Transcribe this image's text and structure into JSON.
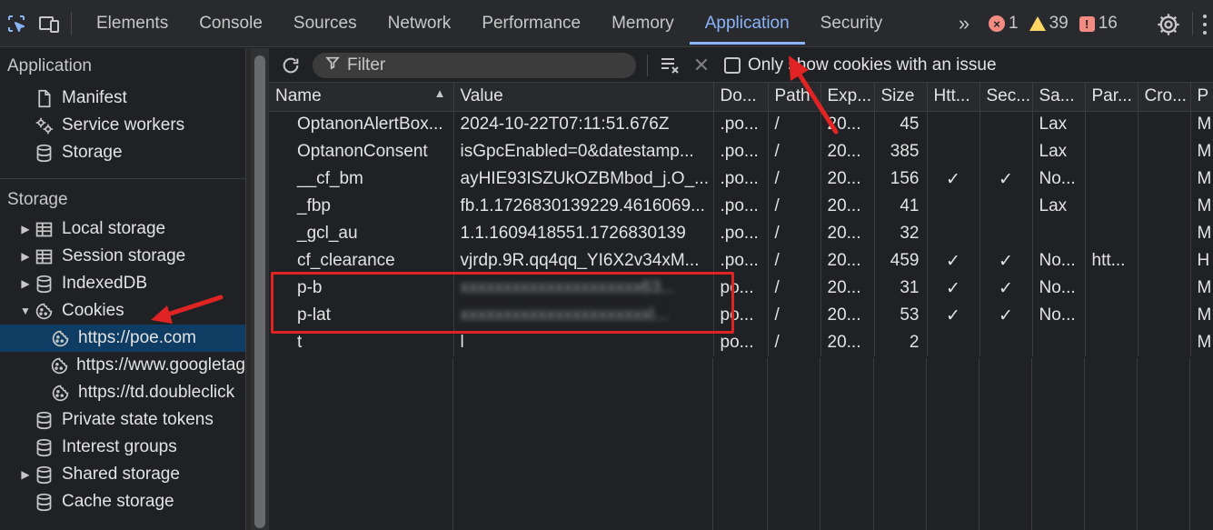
{
  "topbar": {
    "tabs": [
      "Elements",
      "Console",
      "Sources",
      "Network",
      "Performance",
      "Memory",
      "Application",
      "Security"
    ],
    "active_tab": "Application",
    "errors": "1",
    "warnings": "39",
    "issues": "16"
  },
  "sidebar": {
    "application_header": "Application",
    "application_items": [
      {
        "label": "Manifest",
        "icon": "file-icon"
      },
      {
        "label": "Service workers",
        "icon": "gears-icon"
      },
      {
        "label": "Storage",
        "icon": "database-icon"
      }
    ],
    "storage_header": "Storage",
    "storage_items": [
      {
        "label": "Local storage",
        "icon": "grid-icon"
      },
      {
        "label": "Session storage",
        "icon": "grid-icon"
      },
      {
        "label": "IndexedDB",
        "icon": "database-icon"
      },
      {
        "label": "Cookies",
        "icon": "cookie-icon"
      }
    ],
    "cookie_origins": [
      "https://poe.com",
      "https://www.googletag",
      "https://td.doubleclick"
    ],
    "selected_origin": "https://poe.com",
    "lower_items": [
      {
        "label": "Private state tokens",
        "icon": "database-icon"
      },
      {
        "label": "Interest groups",
        "icon": "database-icon"
      },
      {
        "label": "Shared storage",
        "icon": "database-icon"
      },
      {
        "label": "Cache storage",
        "icon": "database-icon"
      }
    ]
  },
  "toolbar": {
    "filter_placeholder": "Filter",
    "only_issues_label": "Only show cookies with an issue"
  },
  "table": {
    "columns": [
      "Name",
      "Value",
      "Do...",
      "Path",
      "Exp...",
      "Size",
      "Htt...",
      "Sec...",
      "Sa...",
      "Par...",
      "Cro...",
      "P"
    ],
    "rows": [
      [
        "OptanonAlertBox...",
        "2024-10-22T07:11:51.676Z",
        ".po...",
        "/",
        "20...",
        "45",
        "",
        "",
        "Lax",
        "",
        "",
        "M"
      ],
      [
        "OptanonConsent",
        "isGpcEnabled=0&datestamp...",
        ".po...",
        "/",
        "20...",
        "385",
        "",
        "",
        "Lax",
        "",
        "",
        "M"
      ],
      [
        "__cf_bm",
        "ayHIE93ISZUkOZBMbod_j.O_...",
        ".po...",
        "/",
        "20...",
        "156",
        "✓",
        "✓",
        "No...",
        "",
        "",
        "M"
      ],
      [
        "_fbp",
        "fb.1.1726830139229.4616069...",
        ".po...",
        "/",
        "20...",
        "41",
        "",
        "",
        "Lax",
        "",
        "",
        "M"
      ],
      [
        "_gcl_au",
        "1.1.1609418551.1726830139",
        ".po...",
        "/",
        "20...",
        "32",
        "",
        "",
        "",
        "",
        "",
        "M"
      ],
      [
        "cf_clearance",
        "vjrdp.9R.qq4qq_YI6X2v34xM...",
        ".po...",
        "/",
        "20...",
        "459",
        "✓",
        "✓",
        "No...",
        "htt...",
        "",
        "H"
      ],
      [
        "p-b",
        "xxxxxxxxxxxxxxxxxxxxx63...",
        "po...",
        "/",
        "20...",
        "31",
        "✓",
        "✓",
        "No...",
        "",
        "",
        "M"
      ],
      [
        "p-lat",
        "xxxxxxxxxxxxxxxxxxxxxxl...",
        "po...",
        "/",
        "20...",
        "53",
        "✓",
        "✓",
        "No...",
        "",
        "",
        "M"
      ],
      [
        "t",
        "l",
        "po...",
        "/",
        "20...",
        "2",
        "",
        "",
        "",
        "",
        "",
        "M"
      ]
    ]
  },
  "colors": {
    "accent": "#8ab4f8",
    "selected_bg": "#0e3c63",
    "annotation_red": "#e02424"
  }
}
